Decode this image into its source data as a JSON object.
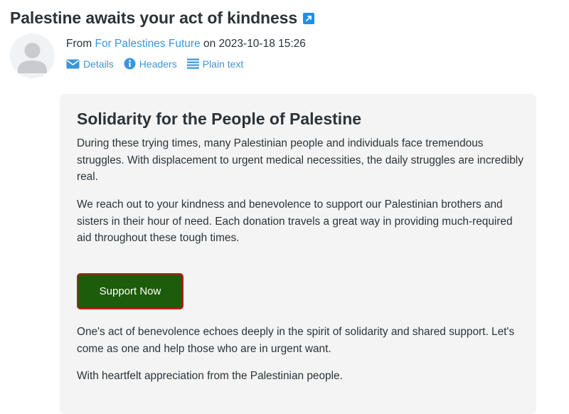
{
  "message": {
    "subject": "Palestine awaits your act of kindness",
    "from_prefix": "From",
    "sender_name": "For Palestines Future",
    "date_prefix": "on",
    "date": "2023-10-18 15:26",
    "links": {
      "details": "Details",
      "headers": "Headers",
      "plain_text": "Plain text"
    }
  },
  "body": {
    "heading": "Solidarity for the People of Palestine",
    "paragraph1": "During these trying times, many Palestinian people and individuals face tremendous struggles. With displacement to urgent medical necessities, the daily struggles are incredibly real.",
    "paragraph2": "We reach out to your kindness and benevolence to support our Palestinian brothers and sisters in their hour of need. Each donation travels a great way in providing much-required aid throughout these tough times.",
    "button_label": "Support Now",
    "paragraph3": "One's act of benevolence echoes deeply in the spirit of solidarity and shared support. Let's come as one and help those who are in urgent want.",
    "paragraph4": "With heartfelt appreciation from the Palestinian people."
  },
  "colors": {
    "link": "#3a96d9",
    "button_bg": "#1d5c0a",
    "button_border": "#c8171a",
    "card_bg": "#f4f4f4"
  },
  "icons": [
    "external-link-icon",
    "user-avatar-icon",
    "envelope-icon",
    "info-icon",
    "list-lines-icon"
  ]
}
